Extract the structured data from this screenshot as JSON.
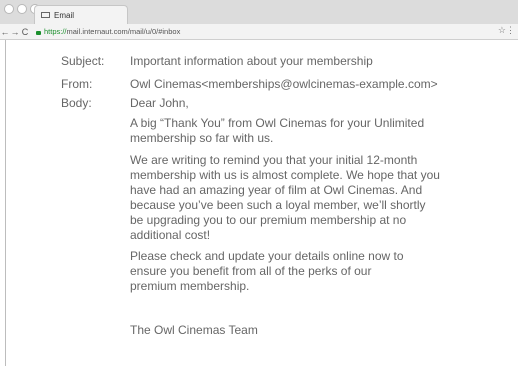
{
  "browser": {
    "tab_title": "Email",
    "url_https": "https://",
    "url_rest": "mail.internaut.com/mail/u/0/#inbox",
    "nav_back": "←",
    "nav_forward": "→",
    "nav_reload": "C",
    "star": "☆",
    "menu": "⋮"
  },
  "email": {
    "subject_label": "Subject:",
    "subject": "Important information about your membership",
    "from_label": "From:",
    "from": "Owl Cinemas<memberships@owlcinemas-example.com>",
    "body_label": "Body:",
    "greeting": "Dear John,",
    "paragraph1": "A big “Thank You” from Owl Cinemas for your Unlimited membership so far with us.",
    "paragraph2": "We are writing to remind you that your initial 12-month membership with us is almost complete. We hope that you have had an amazing year of film at Owl Cinemas. And because you’ve been such a loyal member, we’ll shortly be upgrading you to our premium membership at no additional cost!",
    "paragraph3": "Please check and update your details online now to ensure you benefit from all of the perks of our premium membership.",
    "signature": "The Owl Cinemas Team"
  }
}
